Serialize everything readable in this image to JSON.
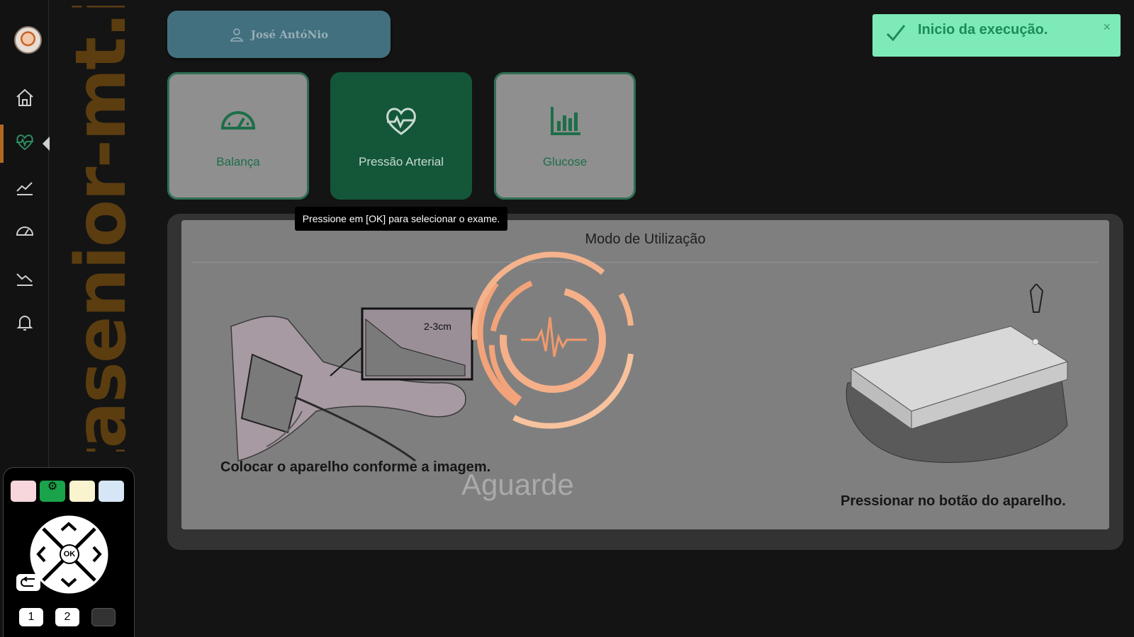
{
  "sidebar": {
    "items": [
      {
        "icon": "home-icon"
      },
      {
        "icon": "heart-pulse-icon",
        "active": true
      },
      {
        "icon": "trend-up-icon"
      },
      {
        "icon": "gauge-icon"
      },
      {
        "icon": "trend-down-icon"
      },
      {
        "icon": "bell-icon"
      }
    ]
  },
  "brand": {
    "text": "vitasenior-mt.ipt"
  },
  "user": {
    "name": "José  AntóNio"
  },
  "exams": [
    {
      "label": "Balança",
      "icon": "scale-gauge-icon"
    },
    {
      "label": "Pressão Arterial",
      "icon": "heart-pulse-icon",
      "selected": true
    },
    {
      "label": "Glucose",
      "icon": "bar-chart-icon"
    }
  ],
  "tooltip": {
    "text": "Pressione em [OK] para selecionar o exame."
  },
  "instructions": {
    "title": "Modo de Utilização",
    "step1": "Colocar o aparelho conforme a imagem.",
    "step2": "Pressionar no botão do aparelho.",
    "cuff_note": "2-3cm",
    "waiting": "Aguarde"
  },
  "toast": {
    "message": "Inicio da execução.",
    "close": "×"
  },
  "remote": {
    "ok": "OK",
    "btn1": "1",
    "btn2": "2",
    "colors": [
      "#f7d6dc",
      "#1aa34a",
      "#faf3cf",
      "#d6e6f7"
    ]
  },
  "colors": {
    "accent_green": "#135738",
    "toast_bg": "#7deab8",
    "brand": "#5b3d10",
    "user_pill": "#42707f"
  }
}
